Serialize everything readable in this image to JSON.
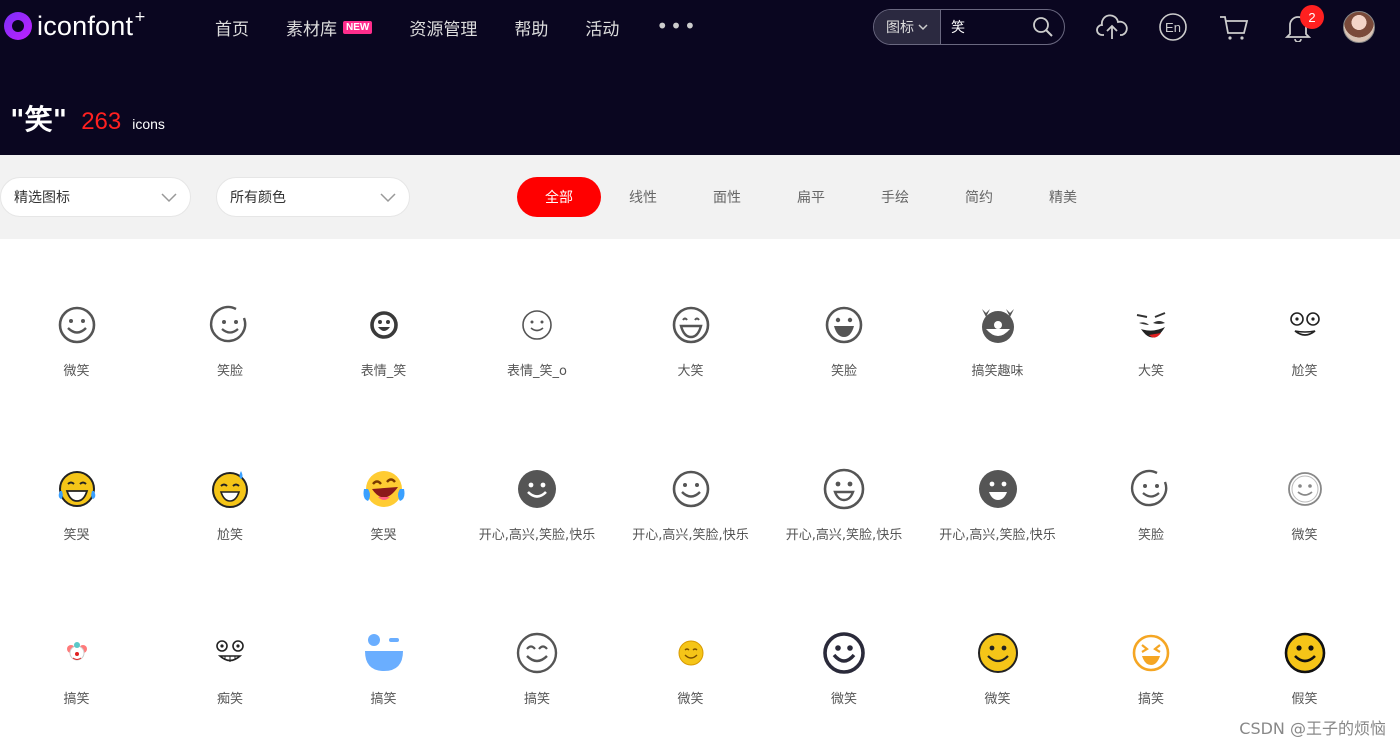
{
  "brand": {
    "name": "iconfont",
    "plus": "+"
  },
  "nav": [
    {
      "label": "首页"
    },
    {
      "label": "素材库",
      "badge": "NEW"
    },
    {
      "label": "资源管理"
    },
    {
      "label": "帮助"
    },
    {
      "label": "活动"
    },
    {
      "label": "•••"
    }
  ],
  "search": {
    "type": "图标",
    "value": "笑"
  },
  "header_icons": {
    "lang": "En",
    "notifications": "2"
  },
  "result": {
    "query": "\"笑\"",
    "count": "263",
    "unit": "icons"
  },
  "filters": {
    "category": "精选图标",
    "color": "所有颜色"
  },
  "tabs": [
    {
      "label": "全部",
      "active": true
    },
    {
      "label": "线性"
    },
    {
      "label": "面性"
    },
    {
      "label": "扁平"
    },
    {
      "label": "手绘"
    },
    {
      "label": "简约"
    },
    {
      "label": "精美"
    }
  ],
  "icons": [
    {
      "label": "微笑",
      "icon": "smile-outline-icon"
    },
    {
      "label": "笑脸",
      "icon": "smile-open-outline-icon"
    },
    {
      "label": "表情_笑",
      "icon": "smile-bold-icon"
    },
    {
      "label": "表情_笑_o",
      "icon": "smile-thin-icon"
    },
    {
      "label": "大笑",
      "icon": "laugh-outline-icon"
    },
    {
      "label": "笑脸",
      "icon": "laugh-teeth-icon"
    },
    {
      "label": "搞笑趣味",
      "icon": "clown-icon"
    },
    {
      "label": "大笑",
      "icon": "cartoon-laugh-icon"
    },
    {
      "label": "尬笑",
      "icon": "awkward-face-icon"
    },
    {
      "label": "笑哭",
      "icon": "tears-of-joy-icon"
    },
    {
      "label": "尬笑",
      "icon": "sweat-smile-icon"
    },
    {
      "label": "笑哭",
      "icon": "rofl-icon"
    },
    {
      "label": "开心,高兴,笑脸,快乐",
      "icon": "smile-filled-icon"
    },
    {
      "label": "开心,高兴,笑脸,快乐",
      "icon": "smile-outline-icon"
    },
    {
      "label": "开心,高兴,笑脸,快乐",
      "icon": "grin-outline-icon"
    },
    {
      "label": "开心,高兴,笑脸,快乐",
      "icon": "grin-filled-icon"
    },
    {
      "label": "笑脸",
      "icon": "smile-open-outline-icon"
    },
    {
      "label": "微笑",
      "icon": "smile-light-icon"
    },
    {
      "label": "搞笑",
      "icon": "mini-clown-icon"
    },
    {
      "label": "痴笑",
      "icon": "silly-face-icon"
    },
    {
      "label": "搞笑",
      "icon": "wink-blue-icon"
    },
    {
      "label": "搞笑",
      "icon": "happy-eyes-icon"
    },
    {
      "label": "微笑",
      "icon": "yellow-smile-small-icon"
    },
    {
      "label": "微笑",
      "icon": "smile-dark-icon"
    },
    {
      "label": "微笑",
      "icon": "yellow-smile-icon"
    },
    {
      "label": "搞笑",
      "icon": "squint-laugh-icon"
    },
    {
      "label": "假笑",
      "icon": "yellow-smile-dark-icon"
    }
  ],
  "watermark": "CSDN @王子的烦恼",
  "colors": {
    "header_bg": "#0a0620",
    "accent": "#ff0000",
    "badge": "#ff2d8c"
  }
}
